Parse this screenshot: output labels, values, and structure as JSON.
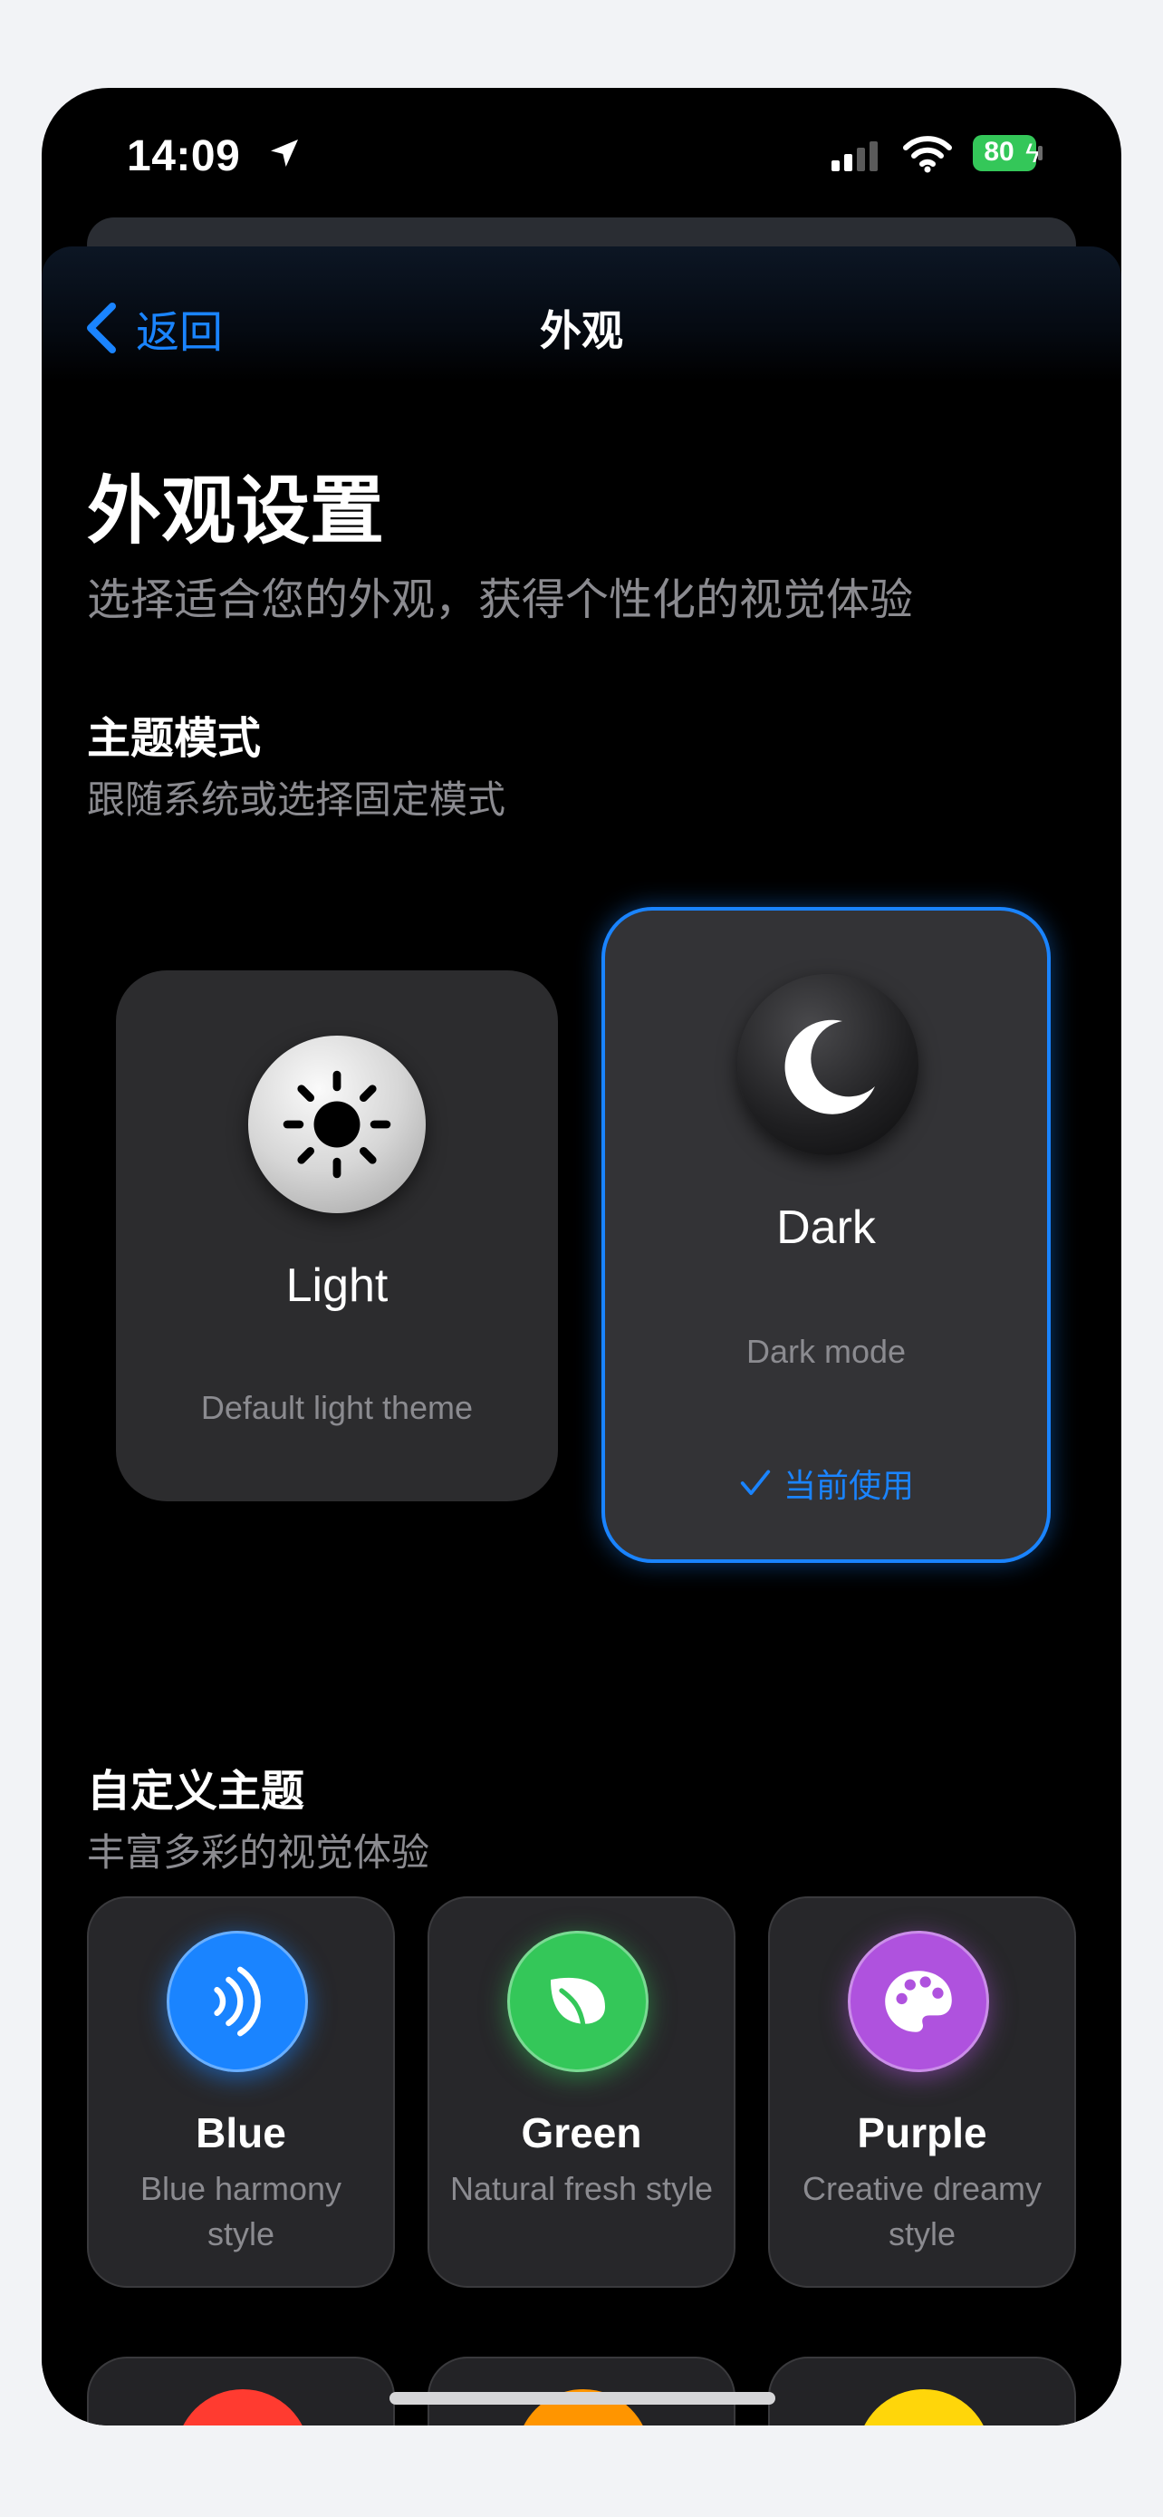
{
  "status_bar": {
    "time": "14:09",
    "battery": "80"
  },
  "nav": {
    "back_label": "返回",
    "title": "外观"
  },
  "page": {
    "title": "外观设置",
    "subtitle": "选择适合您的外观，获得个性化的视觉体验"
  },
  "theme_mode": {
    "title": "主题模式",
    "subtitle": "跟随系统或选择固定模式",
    "options": [
      {
        "name": "Light",
        "desc": "Default light theme",
        "icon": "sun-icon",
        "selected": false
      },
      {
        "name": "Dark",
        "desc": "Dark mode",
        "icon": "moon-icon",
        "selected": true,
        "current_label": "当前使用"
      }
    ]
  },
  "custom_theme": {
    "title": "自定义主题",
    "subtitle": "丰富多彩的视觉体验",
    "themes": [
      {
        "name": "Blue",
        "desc": "Blue harmony style",
        "icon": "waves-icon",
        "color": "#1a84ff"
      },
      {
        "name": "Green",
        "desc": "Natural fresh style",
        "icon": "leaf-icon",
        "color": "#34c759"
      },
      {
        "name": "Purple",
        "desc": "Creative dreamy style",
        "icon": "palette-icon",
        "color": "#af52de"
      }
    ],
    "more_colors": [
      "#ff3b30",
      "#ff9500",
      "#ffd60a"
    ]
  }
}
